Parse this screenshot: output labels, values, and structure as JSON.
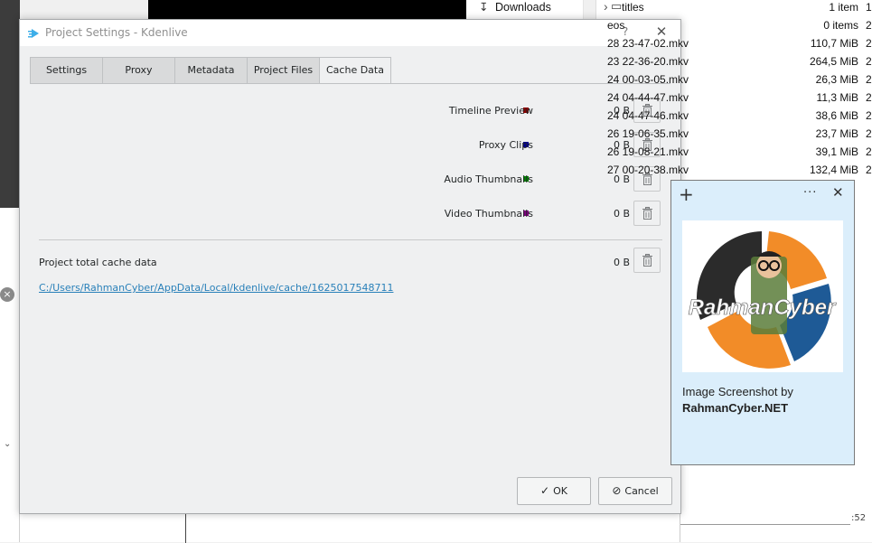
{
  "explorer": {
    "nav_item": "Downloads",
    "files": [
      {
        "name": "titles",
        "size": "1 item",
        "extra": "1",
        "is_folder": true
      },
      {
        "name": "eos",
        "size": "0 items",
        "extra": "2"
      },
      {
        "name": "28 23-47-02.mkv",
        "size": "110,7 MiB",
        "extra": "2"
      },
      {
        "name": "23 22-36-20.mkv",
        "size": "264,5 MiB",
        "extra": "2"
      },
      {
        "name": "24 00-03-05.mkv",
        "size": "26,3 MiB",
        "extra": "2"
      },
      {
        "name": "24 04-44-47.mkv",
        "size": "11,3 MiB",
        "extra": "2"
      },
      {
        "name": "24 04-47-46.mkv",
        "size": "38,6 MiB",
        "extra": "2"
      },
      {
        "name": "26 19-06-35.mkv",
        "size": "23,7 MiB",
        "extra": "2"
      },
      {
        "name": "26 19-08-21.mkv",
        "size": "39,1 MiB",
        "extra": "2"
      },
      {
        "name": "27 00-20-38.mkv",
        "size": "132,4 MiB",
        "extra": "2"
      }
    ],
    "right_strip_text": ":52"
  },
  "dialog": {
    "title": "Project Settings - Kdenlive",
    "help_label": "?",
    "tabs": [
      {
        "label": "Settings"
      },
      {
        "label": "Proxy"
      },
      {
        "label": "Metadata"
      },
      {
        "label": "Project Files"
      },
      {
        "label": "Cache Data",
        "active": true
      }
    ],
    "cache_items": [
      {
        "label": "Timeline Preview",
        "size": "0 B",
        "color": "#8b0000"
      },
      {
        "label": "Proxy Clips",
        "size": "0 B",
        "color": "#00008b"
      },
      {
        "label": "Audio Thumbnails",
        "size": "0 B",
        "color": "#008000"
      },
      {
        "label": "Video Thumbnails",
        "size": "0 B",
        "color": "#800080"
      }
    ],
    "total_label": "Project total cache data",
    "total_size": "0 B",
    "cache_path": "C:/Users/RahmanCyber/AppData/Local/kdenlive/cache/1625017548711",
    "ok_label": "OK",
    "cancel_label": "Cancel"
  },
  "popup": {
    "caption_line1": "Image Screenshot by",
    "caption_line2": "RahmanCyber.NET",
    "logo_text": "RahmanCyber"
  }
}
